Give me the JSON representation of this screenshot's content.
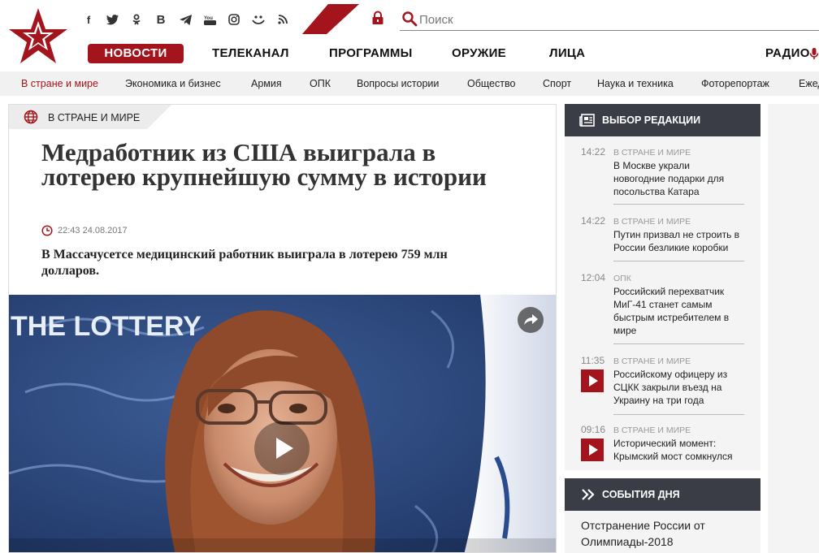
{
  "brand": {
    "accent": "#a4141c",
    "dark": "#3a3d45"
  },
  "social_icons": [
    "facebook-icon",
    "twitter-icon",
    "odnoklassniki-icon",
    "vkontakte-icon",
    "telegram-icon",
    "youtube-icon",
    "instagram-icon",
    "yandex-zen-icon",
    "rss-icon"
  ],
  "search": {
    "placeholder": "Поиск"
  },
  "mainnav": [
    {
      "label": "НОВОСТИ",
      "active": true
    },
    {
      "label": "ТЕЛЕКАНАЛ"
    },
    {
      "label": "ПРОГРАММЫ"
    },
    {
      "label": "ОРУЖИЕ"
    },
    {
      "label": "ЛИЦА"
    },
    {
      "label": "РАДИО"
    }
  ],
  "subnav": [
    "В стране и мире",
    "Экономика и бизнес",
    "Армия",
    "ОПК",
    "Вопросы истории",
    "Общество",
    "Спорт",
    "Наука и техника",
    "Фоторепортаж",
    "Ежедн"
  ],
  "article": {
    "section": "В СТРАНЕ И МИРЕ",
    "title": "Медработник из США выиграла в лотерею крупнейшую сумму в истории",
    "date": "22:43 24.08.2017",
    "lead": "В Массачусетсе медицинский работник выиграла в лотерею 759 млн долларов.",
    "video_backdrop_text": "THE LOTTERY"
  },
  "editors_choice": {
    "title": "ВЫБОР РЕДАКЦИИ",
    "items": [
      {
        "time": "14:22",
        "category": "В СТРАНЕ И МИРЕ",
        "text": "В Москве украли новогодние подарки для посольства Катара",
        "video": false
      },
      {
        "time": "14:22",
        "category": "В СТРАНЕ И МИРЕ",
        "text": "Путин призвал не строить в России безликие коробки",
        "video": false
      },
      {
        "time": "12:04",
        "category": "ОПК",
        "text": "Российский перехватчик МиГ-41 станет самым быстрым истребителем в мире",
        "video": false
      },
      {
        "time": "11:35",
        "category": "В СТРАНЕ И МИРЕ",
        "text": "Российскому офицеру из СЦКК закрыли въезд на Украину на три года",
        "video": true
      },
      {
        "time": "09:16",
        "category": "В СТРАНЕ И МИРЕ",
        "text": "Исторический момент: Крымский мост сомкнулся",
        "video": true
      }
    ]
  },
  "events": {
    "title": "СОБЫТИЯ ДНЯ",
    "items": [
      "Отстранение России от Олимпиады-2018"
    ]
  }
}
